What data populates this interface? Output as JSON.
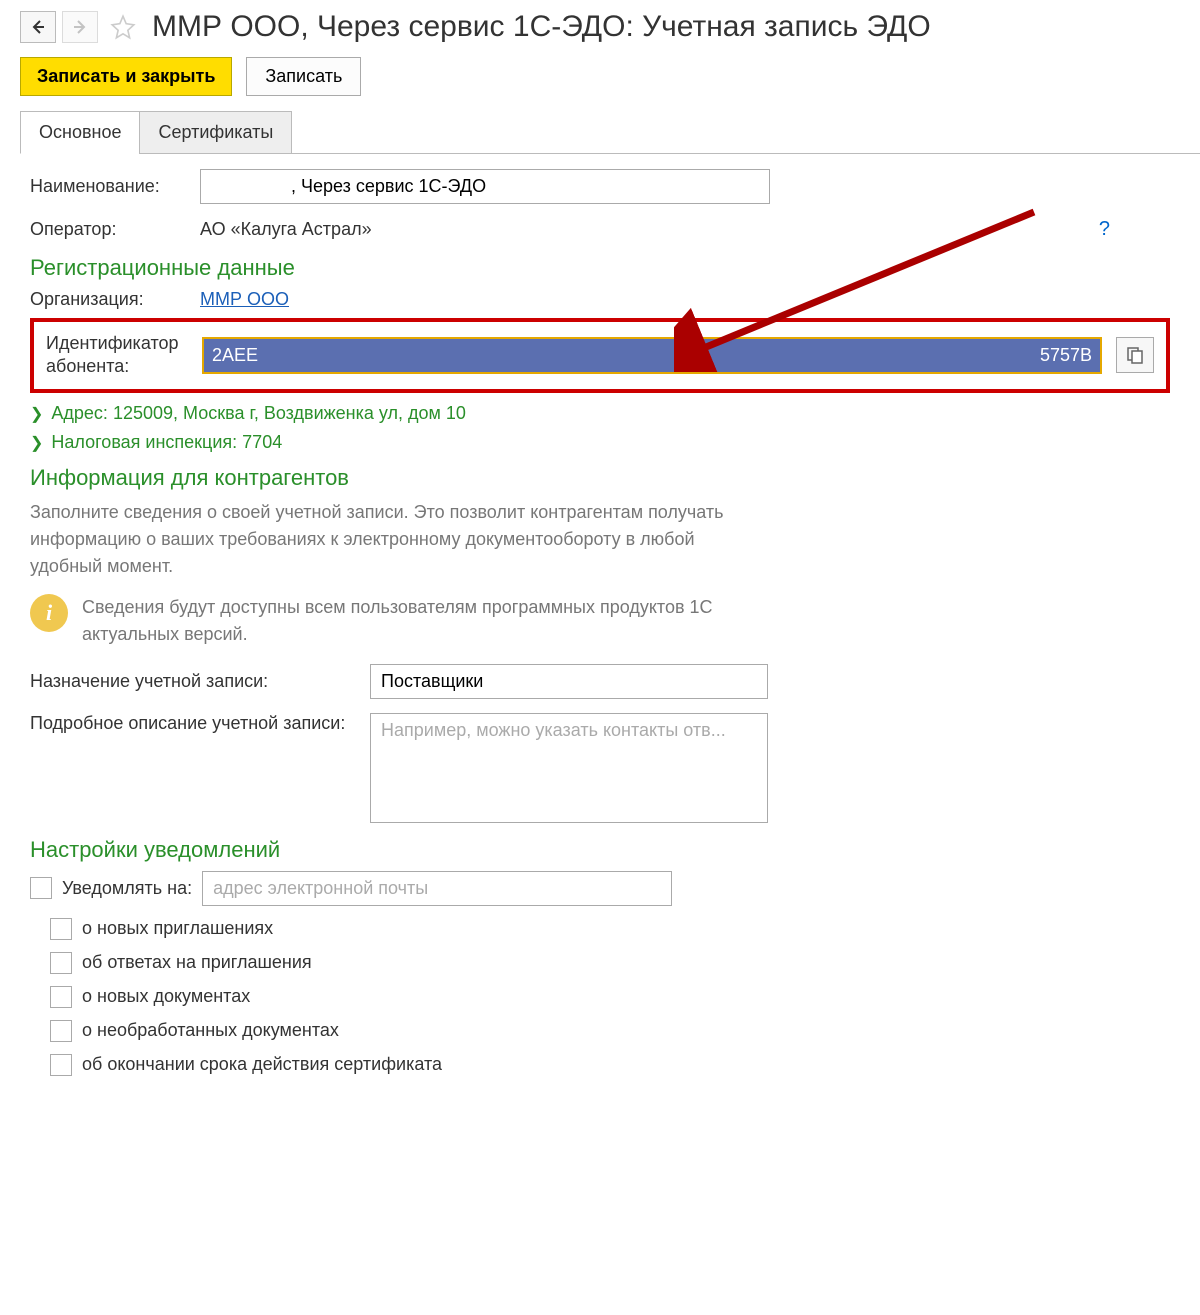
{
  "header": {
    "title": "ММР ООО, Через сервис 1С-ЭДО: Учетная запись ЭДО"
  },
  "toolbar": {
    "save_close": "Записать и закрыть",
    "save": "Записать"
  },
  "tabs": [
    {
      "label": "Основное",
      "active": true
    },
    {
      "label": "Сертификаты",
      "active": false
    }
  ],
  "main": {
    "name_label": "Наименование:",
    "name_value": ", Через сервис 1С-ЭДО",
    "operator_label": "Оператор:",
    "operator_value": "АО «Калуга Астрал»",
    "help": "?",
    "reg_section": "Регистрационные данные",
    "org_label": "Организация:",
    "org_value": "ММР ООО",
    "subscriber_id_label1": "Идентификатор",
    "subscriber_id_label2": "абонента:",
    "subscriber_id_left": "2AEE",
    "subscriber_id_right": "5757B",
    "address_label": "Адрес: 125009, Москва г, Воздвиженка ул, дом 10",
    "tax_label": "Налоговая инспекция: 7704",
    "counterparty_section": "Информация для контрагентов",
    "counterparty_desc": "Заполните сведения о своей учетной записи. Это позволит контрагентам получать информацию о ваших требованиях к электронному документообороту в любой удобный момент.",
    "info_note": "Сведения будут доступны всем пользователям программных продуктов 1С актуальных версий.",
    "purpose_label": "Назначение учетной записи:",
    "purpose_value": "Поставщики",
    "description_label": "Подробное описание учетной записи:",
    "description_placeholder": "Например, можно указать контакты отв...",
    "notify_section": "Настройки уведомлений",
    "notify_on_label": "Уведомлять на:",
    "notify_email_placeholder": "адрес электронной почты",
    "notify_options": [
      "о новых приглашениях",
      "об ответах на приглашения",
      "о новых документах",
      "о необработанных документах",
      "об окончании срока действия сертификата"
    ]
  }
}
